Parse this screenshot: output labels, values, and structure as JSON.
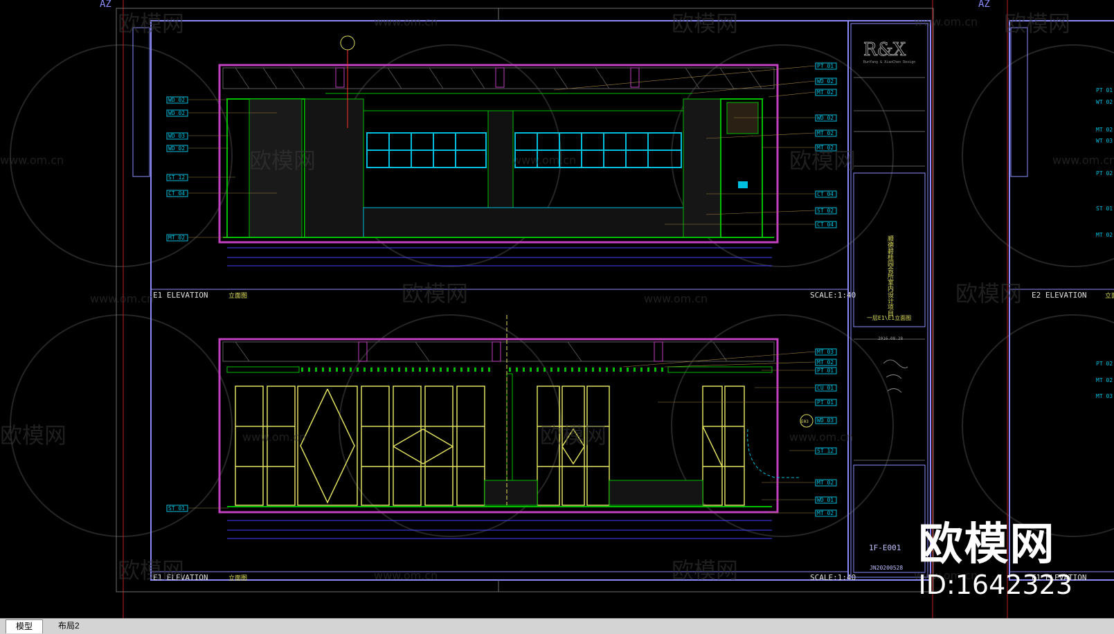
{
  "drawing": {
    "corner_label_left": "AZ",
    "corner_label_right": "AZ",
    "elevation_top": {
      "label": "E1 ELEVATION",
      "subtitle": "立面图",
      "scale": "SCALE:1:40"
    },
    "elevation_bottom": {
      "label": "E1 ELEVATION",
      "subtitle": "立面图",
      "scale": "SCALE:1:40"
    },
    "right_partial_elevation": {
      "label": "E2 ELEVATION",
      "subtitle": "立面"
    },
    "right_partial_elevation_bottom": {
      "label": "E1 ELEVATION"
    },
    "top_left_tags": [
      "WD 02",
      "WD 02",
      "WD 03",
      "WD 02",
      "ST 12",
      "CT 04",
      "MT 02"
    ],
    "top_right_tags": [
      "PT 01",
      "WD 02",
      "MT 02",
      "WD 02",
      "MT 02",
      "MT 02",
      "CT 04",
      "ST 02",
      "CT 04"
    ],
    "bottom_left_tags": [
      "ST 01"
    ],
    "bottom_right_tags": [
      "MT 03",
      "MT 02",
      "PT 01",
      "CU 01",
      "PT 01",
      "WD 03",
      "ST 12",
      "MT 02",
      "WD 01",
      "MT 02"
    ],
    "far_right_tags": [
      "PT 01",
      "WT 02",
      "MT 02",
      "WT 03",
      "PT 02",
      "ST 01",
      "MT 02",
      "PT 02",
      "MT 02",
      "MT 03"
    ],
    "section_marker": "E03"
  },
  "title_block": {
    "logo": "R&X",
    "logo_sub": "RunYang & XiaoChen Design",
    "project_vertical": "顺德碧桂园会所室内设计项目",
    "sheet_name": "一层E1\\E1立面图",
    "date": "2016.08.28",
    "sheet_no": "1F-E001",
    "job_no": "JN20200528"
  },
  "watermark": {
    "brand": "欧模网",
    "url": "www.om.cn",
    "corner_brand": "欧模网",
    "corner_id": "ID:1642323"
  },
  "tabs": [
    {
      "label": "模型",
      "active": true
    },
    {
      "label": "布局2",
      "active": false
    }
  ],
  "colors": {
    "frame_blue": "#8c8cff",
    "magenta": "#c040c0",
    "green": "#00c000",
    "cyan": "#00c0e0",
    "yellow": "#e0e060",
    "red": "#ff3030"
  }
}
